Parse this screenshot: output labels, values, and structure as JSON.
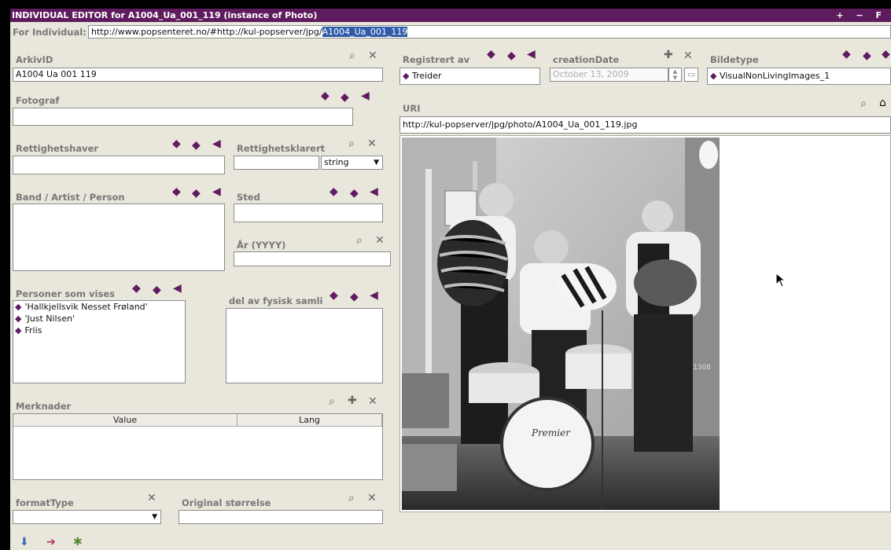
{
  "window": {
    "title": "INDIVIDUAL EDITOR for A1004_Ua_001_119   (instance of Photo)",
    "controls": "+ − F"
  },
  "individual": {
    "label": "For Individual:",
    "url_prefix": "http://www.popsenteret.no/#http://kul-popserver/jpg/",
    "url_selected": "A1004_Ua_001_119"
  },
  "fields": {
    "arkivid": {
      "label": "ArkivID",
      "value": "A1004 Ua 001 119"
    },
    "fotograf": {
      "label": "Fotograf",
      "value": ""
    },
    "rettighetshaver": {
      "label": "Rettighetshaver",
      "value": ""
    },
    "rettighetsklarert": {
      "label": "Rettighetsklarert",
      "value": "",
      "type_value": "string"
    },
    "band": {
      "label": "Band / Artist / Person",
      "value": ""
    },
    "sted": {
      "label": "Sted",
      "value": ""
    },
    "aar": {
      "label": "År (YYYY)",
      "value": ""
    },
    "personer": {
      "label": "Personer som vises",
      "items": [
        "'Hallkjellsvik Nesset Frøland'",
        "'Just Nilsen'",
        "Friis"
      ]
    },
    "del_av": {
      "label": "del av fysisk samli",
      "value": ""
    },
    "merknader": {
      "label": "Merknader",
      "col_value": "Value",
      "col_lang": "Lang"
    },
    "formattype": {
      "label": "formatType",
      "value": ""
    },
    "original": {
      "label": "Original størrelse",
      "value": ""
    },
    "registrert": {
      "label": "Registrert av",
      "value": "Treider"
    },
    "creationdate": {
      "label": "creationDate",
      "value": "October 13, 2009"
    },
    "bildetype": {
      "label": "Bildetype",
      "value": "VisualNonLivingImages_1"
    },
    "uri": {
      "label": "URI",
      "value": "http://kul-popserver/jpg/photo/A1004_Ua_001_119.jpg"
    }
  },
  "photo": {
    "drum_brand": "Premier",
    "drum_number": "1308"
  },
  "icons": {
    "search": "⌕",
    "delete": "✕",
    "add": "✚",
    "tag": "◆"
  }
}
